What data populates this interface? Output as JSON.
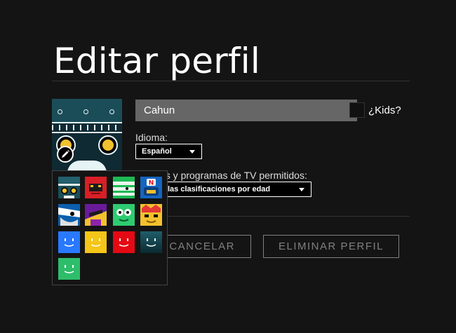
{
  "page": {
    "title": "Editar perfil"
  },
  "profile": {
    "name_value": "Cahun",
    "kids_label": "¿Kids?",
    "language_label": "Idioma:",
    "language_value": "Español",
    "maturity_label": "Películas y programas de TV permitidos:",
    "maturity_label_visible": "as y programas de TV permitidos:",
    "maturity_value_visible": "las clasificaciones por edad"
  },
  "actions": {
    "cancel_label": "CANCELAR",
    "delete_label": "ELIMINAR PERFIL"
  },
  "avatar_picker": {
    "avatars": [
      {
        "name": "robot-avatar",
        "color": "#1b4d58"
      },
      {
        "name": "red-angry-avatar",
        "color": "#d81f26"
      },
      {
        "name": "green-mummy-avatar",
        "color": "#1db954"
      },
      {
        "name": "netflix-robot-avatar",
        "color": "#1565c0"
      },
      {
        "name": "pirate-avatar",
        "color": "#0b5fad"
      },
      {
        "name": "purple-villain-avatar",
        "color": "#6a1b9a"
      },
      {
        "name": "green-alien-avatar",
        "color": "#2ecc71"
      },
      {
        "name": "yellow-king-avatar",
        "color": "#f2c12e"
      },
      {
        "name": "blue-smile-avatar",
        "color": "#2979ff"
      },
      {
        "name": "yellow-smile-avatar",
        "color": "#f5c518"
      },
      {
        "name": "red-smile-avatar",
        "color": "#e50914"
      },
      {
        "name": "teal-smile-avatar",
        "color": "#0f3c47"
      },
      {
        "name": "green-smile-avatar",
        "color": "#2ebd6b"
      }
    ]
  },
  "icons": {
    "edit": "pencil-icon",
    "caret": "caret-down-icon"
  }
}
